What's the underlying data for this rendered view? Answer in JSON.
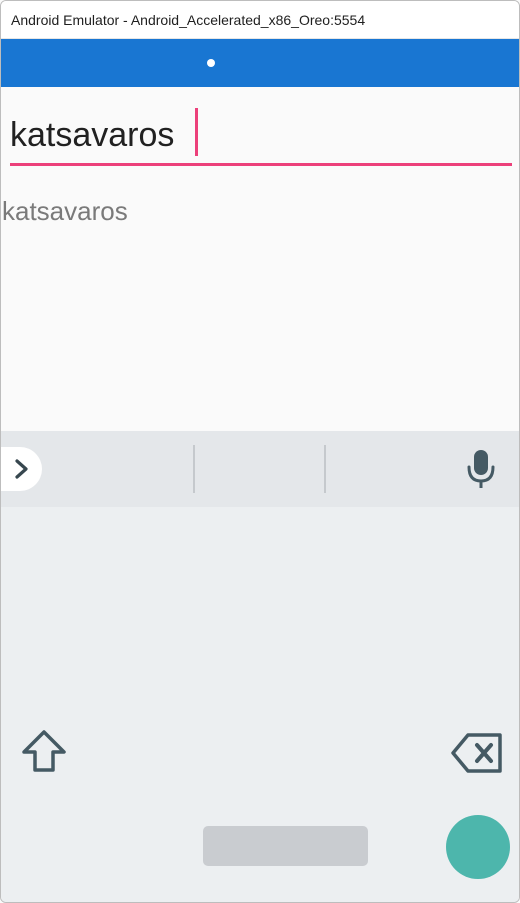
{
  "window": {
    "title": "Android Emulator - Android_Accelerated_x86_Oreo:5554"
  },
  "search": {
    "value": "katsavaros"
  },
  "results": [
    {
      "text": "katsavaros"
    }
  ],
  "keyboard": {
    "expand_icon": "chevron-right-icon",
    "mic_icon": "microphone-icon",
    "shift_icon": "shift-arrow-icon",
    "backspace_icon": "backspace-icon"
  },
  "colors": {
    "appbar": "#1976d2",
    "accent": "#ec407a",
    "fab": "#4db6ac"
  }
}
